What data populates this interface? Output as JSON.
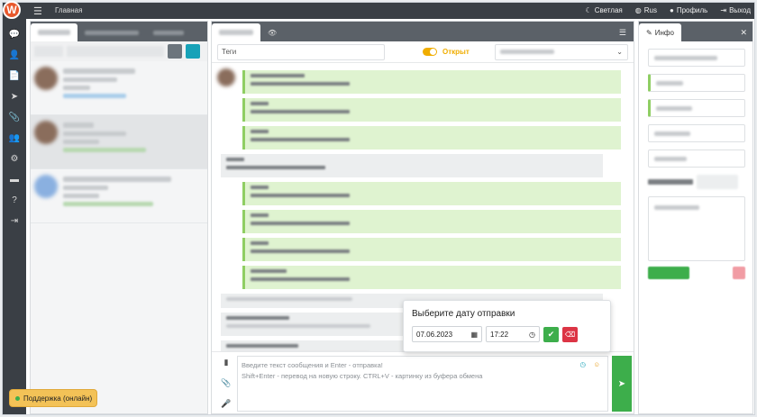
{
  "topbar": {
    "logo": "W",
    "home": "Главная",
    "theme": "Светлая",
    "lang": "Rus",
    "profile": "Профиль",
    "logout": "Выход"
  },
  "chat": {
    "tags_placeholder": "Теги",
    "status": "Открыт"
  },
  "composer": {
    "line1": "Введите текст сообщения и Enter - отправка!",
    "line2": "Shift+Enter - перевод на новую строку. CTRL+V - картинку из буфера обмена"
  },
  "schedule": {
    "title": "Выберите дату отправки",
    "date": "07.06.2023",
    "time": "17:22"
  },
  "info": {
    "tab": "Инфо"
  },
  "support": {
    "label": "Поддержка (онлайн)"
  },
  "colors": {
    "accent": "#3dae4b",
    "brand": "#e8582c",
    "warning": "#f0ad00",
    "danger": "#dc3545"
  }
}
